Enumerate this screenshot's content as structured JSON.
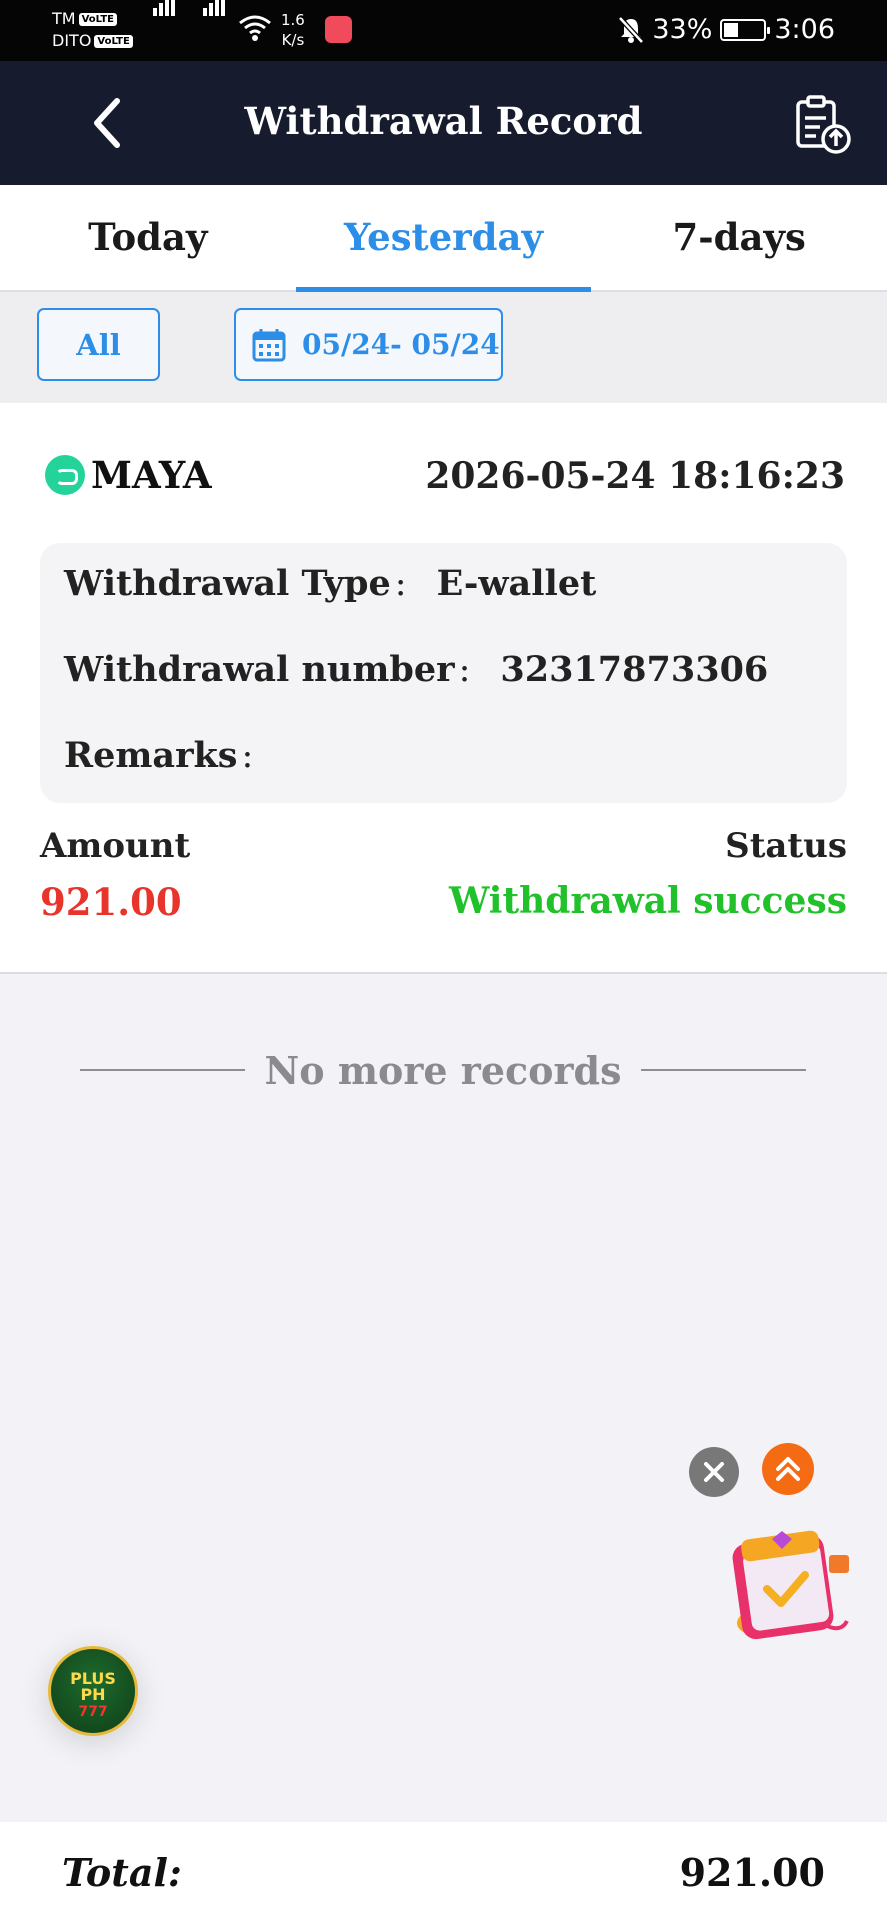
{
  "status_bar": {
    "carrier1": "TM",
    "carrier2": "DITO",
    "volte": "VoLTE",
    "speed_value": "1.6",
    "speed_unit": "K/s",
    "battery": "33%",
    "time": "3:06"
  },
  "header": {
    "title": "Withdrawal Record",
    "back_icon": "chevron-left-icon",
    "action_icon": "clipboard-upload-icon"
  },
  "tabs": [
    {
      "label": "Today",
      "active": false
    },
    {
      "label": "Yesterday",
      "active": true
    },
    {
      "label": "7-days",
      "active": false
    }
  ],
  "filters": {
    "type_label": "All",
    "date_range": "05/24- 05/24"
  },
  "record": {
    "method": "MAYA",
    "datetime": "2026-05-24 18:16:23",
    "type_label": "Withdrawal Type",
    "type_value": "E-wallet",
    "number_label": "Withdrawal number",
    "number_value": "32317873306",
    "remarks_label": "Remarks",
    "remarks_value": "",
    "colon": ":",
    "amount_label": "Amount",
    "amount_value": "921.00",
    "status_label": "Status",
    "status_value": "Withdrawal success"
  },
  "no_more": "No more records",
  "floating": {
    "logo_text1": "PLUS",
    "logo_text2": "PH",
    "logo_text3": "777"
  },
  "footer": {
    "total_label": "Total:",
    "total_value": "921.00"
  },
  "colors": {
    "header_bg": "#161c2e",
    "accent": "#2c8ee6",
    "amount": "#e8342a",
    "success": "#20c12a"
  }
}
